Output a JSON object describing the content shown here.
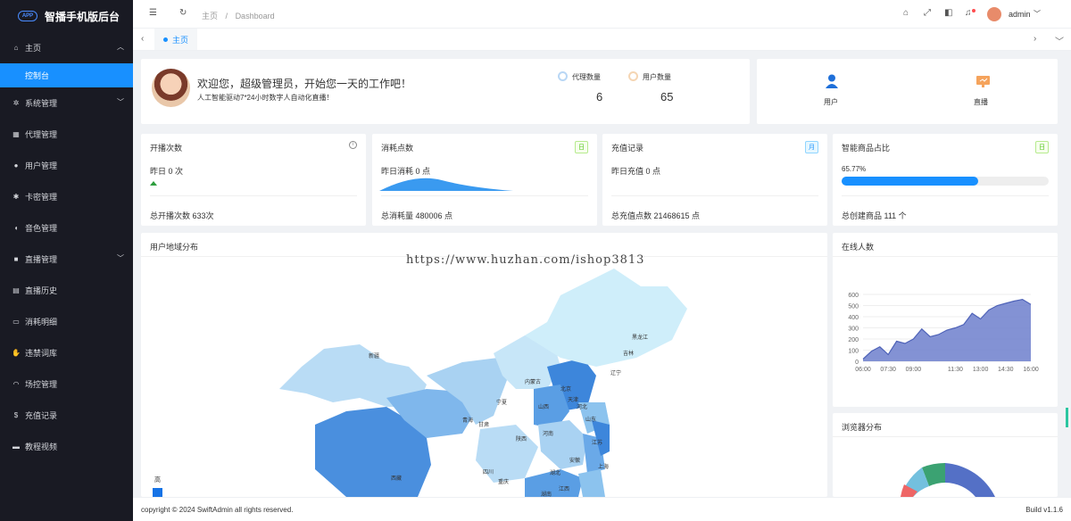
{
  "app": {
    "title": "智播手机版后台",
    "logo_text": "APP"
  },
  "sidebar": {
    "items": [
      {
        "icon": "⌂",
        "label": "主页",
        "arrow": "︿",
        "sub": "控制台"
      },
      {
        "icon": "✲",
        "label": "系统管理",
        "arrow": "﹀"
      },
      {
        "icon": "▦",
        "label": "代理管理"
      },
      {
        "icon": "●",
        "label": "用户管理"
      },
      {
        "icon": "✱",
        "label": "卡密管理"
      },
      {
        "icon": "◖",
        "label": "音色管理"
      },
      {
        "icon": "■",
        "label": "直播管理",
        "arrow": "﹀"
      },
      {
        "icon": "▤",
        "label": "直播历史"
      },
      {
        "icon": "▭",
        "label": "消耗明细"
      },
      {
        "icon": "✋",
        "label": "违禁词库"
      },
      {
        "icon": "◠",
        "label": "场控管理"
      },
      {
        "icon": "$",
        "label": "充值记录"
      },
      {
        "icon": "▬",
        "label": "教程视频"
      }
    ]
  },
  "header": {
    "breadcrumb": [
      "主页",
      "Dashboard"
    ],
    "separator": "/",
    "user": "admin"
  },
  "tabs": [
    {
      "label": "主页"
    }
  ],
  "welcome": {
    "title": "欢迎您，超级管理员，开始您一天的工作吧！",
    "subtitle": "人工智能驱动7*24小时数字人自动化直播！",
    "stats": [
      {
        "label": "代理数量",
        "value": "6"
      },
      {
        "label": "用户数量",
        "value": "65"
      }
    ]
  },
  "shortcuts": [
    {
      "label": "用户"
    },
    {
      "label": "直播"
    }
  ],
  "metrics": [
    {
      "title": "开播次数",
      "line1": "昨日 0 次",
      "footer": "总开播次数 633次"
    },
    {
      "title": "消耗点数",
      "badge": "日",
      "line1": "昨日消耗 0 点",
      "footer": "总消耗量 480006 点"
    },
    {
      "title": "充值记录",
      "badge": "月",
      "line1": "昨日充值 0 点",
      "footer": "总充值点数 21468615 点"
    },
    {
      "title": "智能商品占比",
      "badge": "日",
      "line1": "65.77%",
      "progress": 0.6577,
      "footer": "总创建商品 111 个"
    }
  ],
  "map": {
    "title": "用户地域分布",
    "legend_high": "高",
    "provinces": [
      "新疆",
      "西藏",
      "青海",
      "甘肃",
      "宁夏",
      "内蒙古",
      "黑龙江",
      "吉林",
      "辽宁",
      "北京",
      "天津",
      "河北",
      "山西",
      "山东",
      "陕西",
      "河南",
      "四川",
      "重庆",
      "湖北",
      "安徽",
      "江苏",
      "上海",
      "湖南",
      "江西"
    ]
  },
  "online": {
    "title": "在线人数"
  },
  "browser": {
    "title": "浏览器分布"
  },
  "footer": {
    "copyright": "copyright © 2024 SwiftAdmin all rights reserved.",
    "build": "Build v1.1.6"
  },
  "watermark": "https://www.huzhan.com/ishop3813",
  "colors": {
    "sidebar": "#191a23",
    "accent": "#1890ff",
    "area": "#6d7fcc",
    "map_dark": "#4a90e2",
    "map_light": "#cfeefa"
  },
  "chart_data": {
    "type": "area",
    "x": [
      "06:00",
      "06:30",
      "07:00",
      "07:30",
      "08:00",
      "08:30",
      "09:00",
      "09:30",
      "10:00",
      "10:30",
      "11:00",
      "11:30",
      "12:00",
      "12:30",
      "13:00",
      "13:30",
      "14:00",
      "14:30",
      "15:00",
      "15:30",
      "16:00"
    ],
    "values": [
      20,
      90,
      130,
      60,
      180,
      160,
      200,
      290,
      220,
      240,
      280,
      300,
      330,
      430,
      380,
      460,
      500,
      520,
      540,
      555,
      510
    ],
    "ylim": [
      0,
      600
    ],
    "yticks": [
      0,
      100,
      200,
      300,
      400,
      500,
      600
    ],
    "xticks": [
      "06:00",
      "07:30",
      "09:00",
      "11:30",
      "13:00",
      "14:30",
      "16:00"
    ],
    "xticks_at": [
      0,
      3,
      6,
      11,
      14,
      17,
      20
    ]
  }
}
